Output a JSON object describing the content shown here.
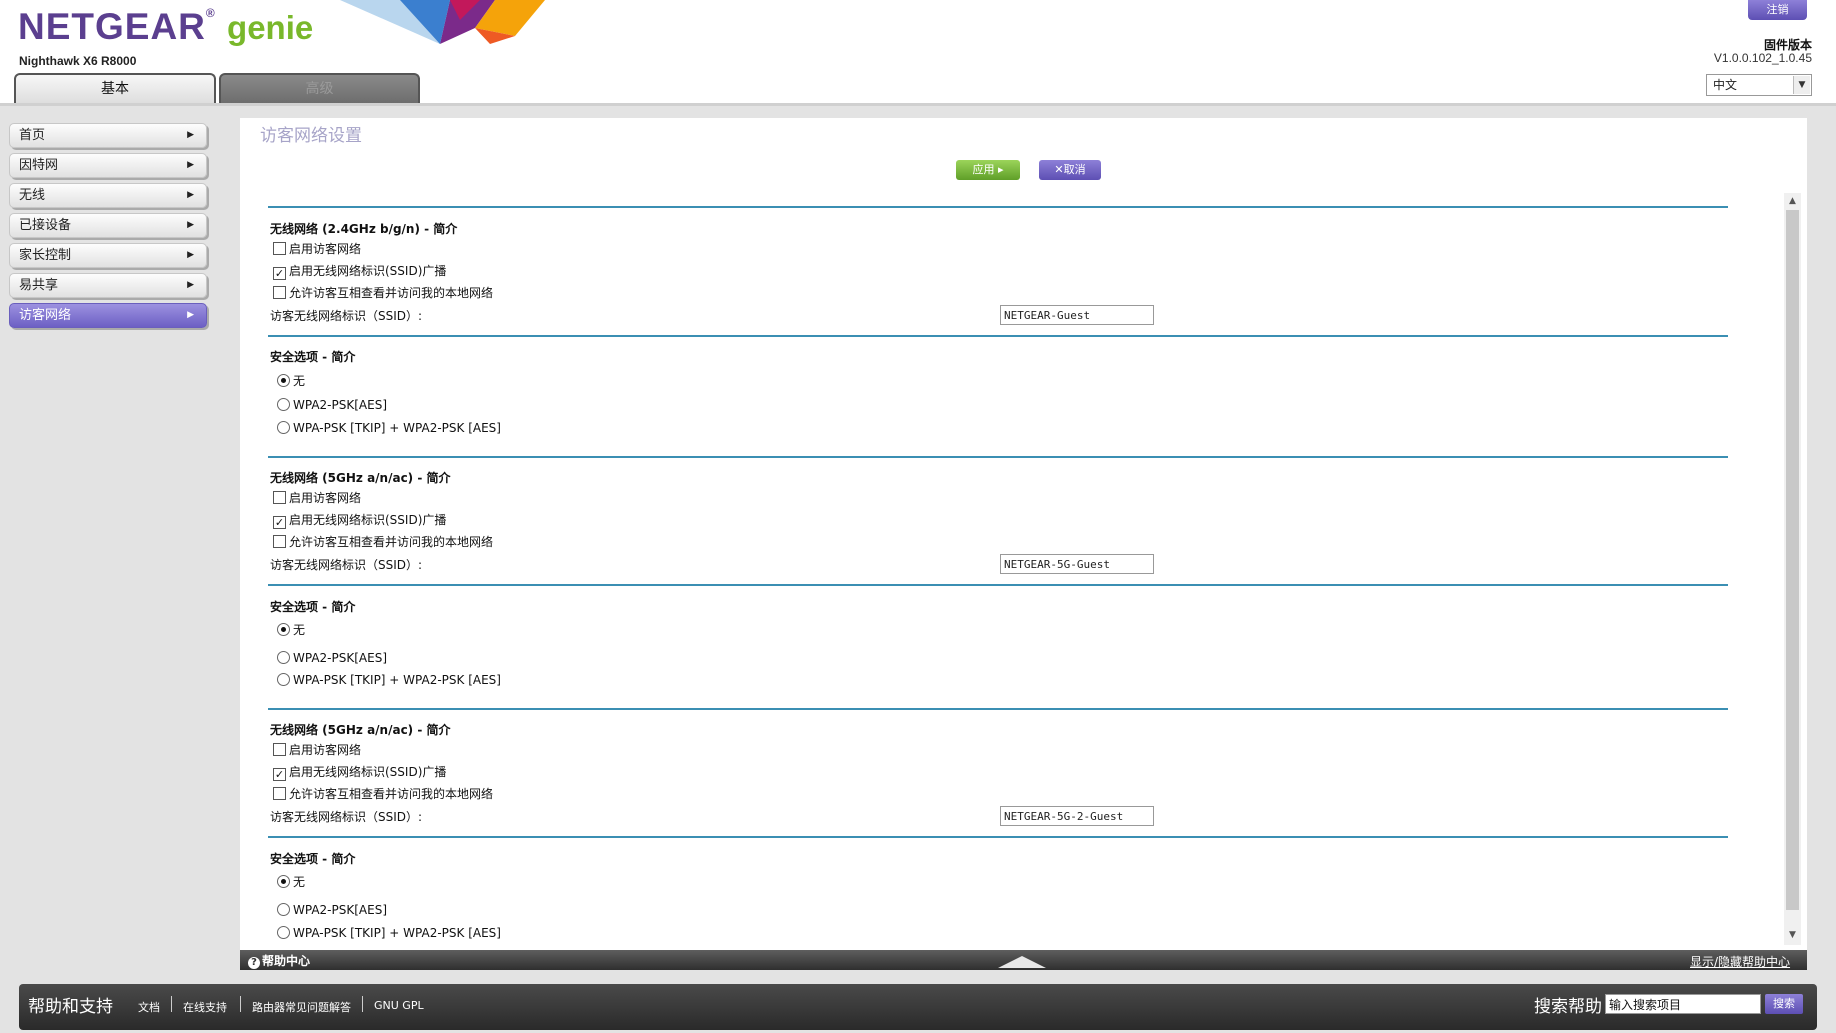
{
  "header": {
    "logo_brand": "NETGEAR",
    "logo_product": "genie",
    "model": "Nighthawk X6 R8000",
    "logout": "注销",
    "firmware_label": "固件版本",
    "firmware_version": "V1.0.0.102_1.0.45",
    "language": "中文",
    "tabs": [
      "基本",
      "高级"
    ]
  },
  "nav": {
    "items": [
      {
        "label": "首页"
      },
      {
        "label": "因特网"
      },
      {
        "label": "无线"
      },
      {
        "label": "已接设备"
      },
      {
        "label": "家长控制"
      },
      {
        "label": "易共享"
      },
      {
        "label": "访客网络"
      }
    ],
    "active": "访客网络"
  },
  "main": {
    "title": "访客网络设置",
    "apply": "应用 ▸",
    "cancel": "✕取消",
    "networks": [
      {
        "heading": "无线网络 (2.4GHz b/g/n) - 简介",
        "enable_guest": "启用访客网络",
        "enable_guest_checked": false,
        "ssid_broadcast": "启用无线网络标识(SSID)广播",
        "ssid_broadcast_checked": true,
        "allow_local": "允许访客互相查看并访问我的本地网络",
        "allow_local_checked": false,
        "ssid_label": "访客无线网络标识（SSID）:",
        "ssid_value": "NETGEAR-Guest",
        "security_heading": "安全选项 - 简介",
        "security_options": [
          "无",
          "WPA2-PSK[AES]",
          "WPA-PSK [TKIP] + WPA2-PSK [AES]"
        ],
        "security_selected": "无"
      },
      {
        "heading": "无线网络 (5GHz a/n/ac) - 简介",
        "enable_guest": "启用访客网络",
        "enable_guest_checked": false,
        "ssid_broadcast": "启用无线网络标识(SSID)广播",
        "ssid_broadcast_checked": true,
        "allow_local": "允许访客互相查看并访问我的本地网络",
        "allow_local_checked": false,
        "ssid_label": "访客无线网络标识（SSID）:",
        "ssid_value": "NETGEAR-5G-Guest",
        "security_heading": "安全选项 - 简介",
        "security_options": [
          "无",
          "WPA2-PSK[AES]",
          "WPA-PSK [TKIP] + WPA2-PSK [AES]"
        ],
        "security_selected": "无"
      },
      {
        "heading": "无线网络 (5GHz a/n/ac) - 简介",
        "enable_guest": "启用访客网络",
        "enable_guest_checked": false,
        "ssid_broadcast": "启用无线网络标识(SSID)广播",
        "ssid_broadcast_checked": true,
        "allow_local": "允许访客互相查看并访问我的本地网络",
        "allow_local_checked": false,
        "ssid_label": "访客无线网络标识（SSID）:",
        "ssid_value": "NETGEAR-5G-2-Guest",
        "security_heading": "安全选项 - 简介",
        "security_options": [
          "无",
          "WPA2-PSK[AES]",
          "WPA-PSK [TKIP] + WPA2-PSK [AES]"
        ],
        "security_selected": "无"
      }
    ]
  },
  "help_bar": {
    "help_center": "帮助中心",
    "show_hide": "显示/隐藏帮助中心"
  },
  "footer": {
    "title": "帮助和支持",
    "links": [
      "文档",
      "在线支持",
      "路由器常见问题解答",
      "GNU GPL"
    ],
    "search_label": "搜索帮助",
    "search_placeholder": "输入搜索项目",
    "search_button": "搜索"
  },
  "colors": {
    "brand_purple": "#5b3f8f",
    "genie_green": "#79b82b",
    "button_purple": "#6d60c4",
    "apply_green": "#6aab2e",
    "section_rule": "#3b8fb3"
  }
}
